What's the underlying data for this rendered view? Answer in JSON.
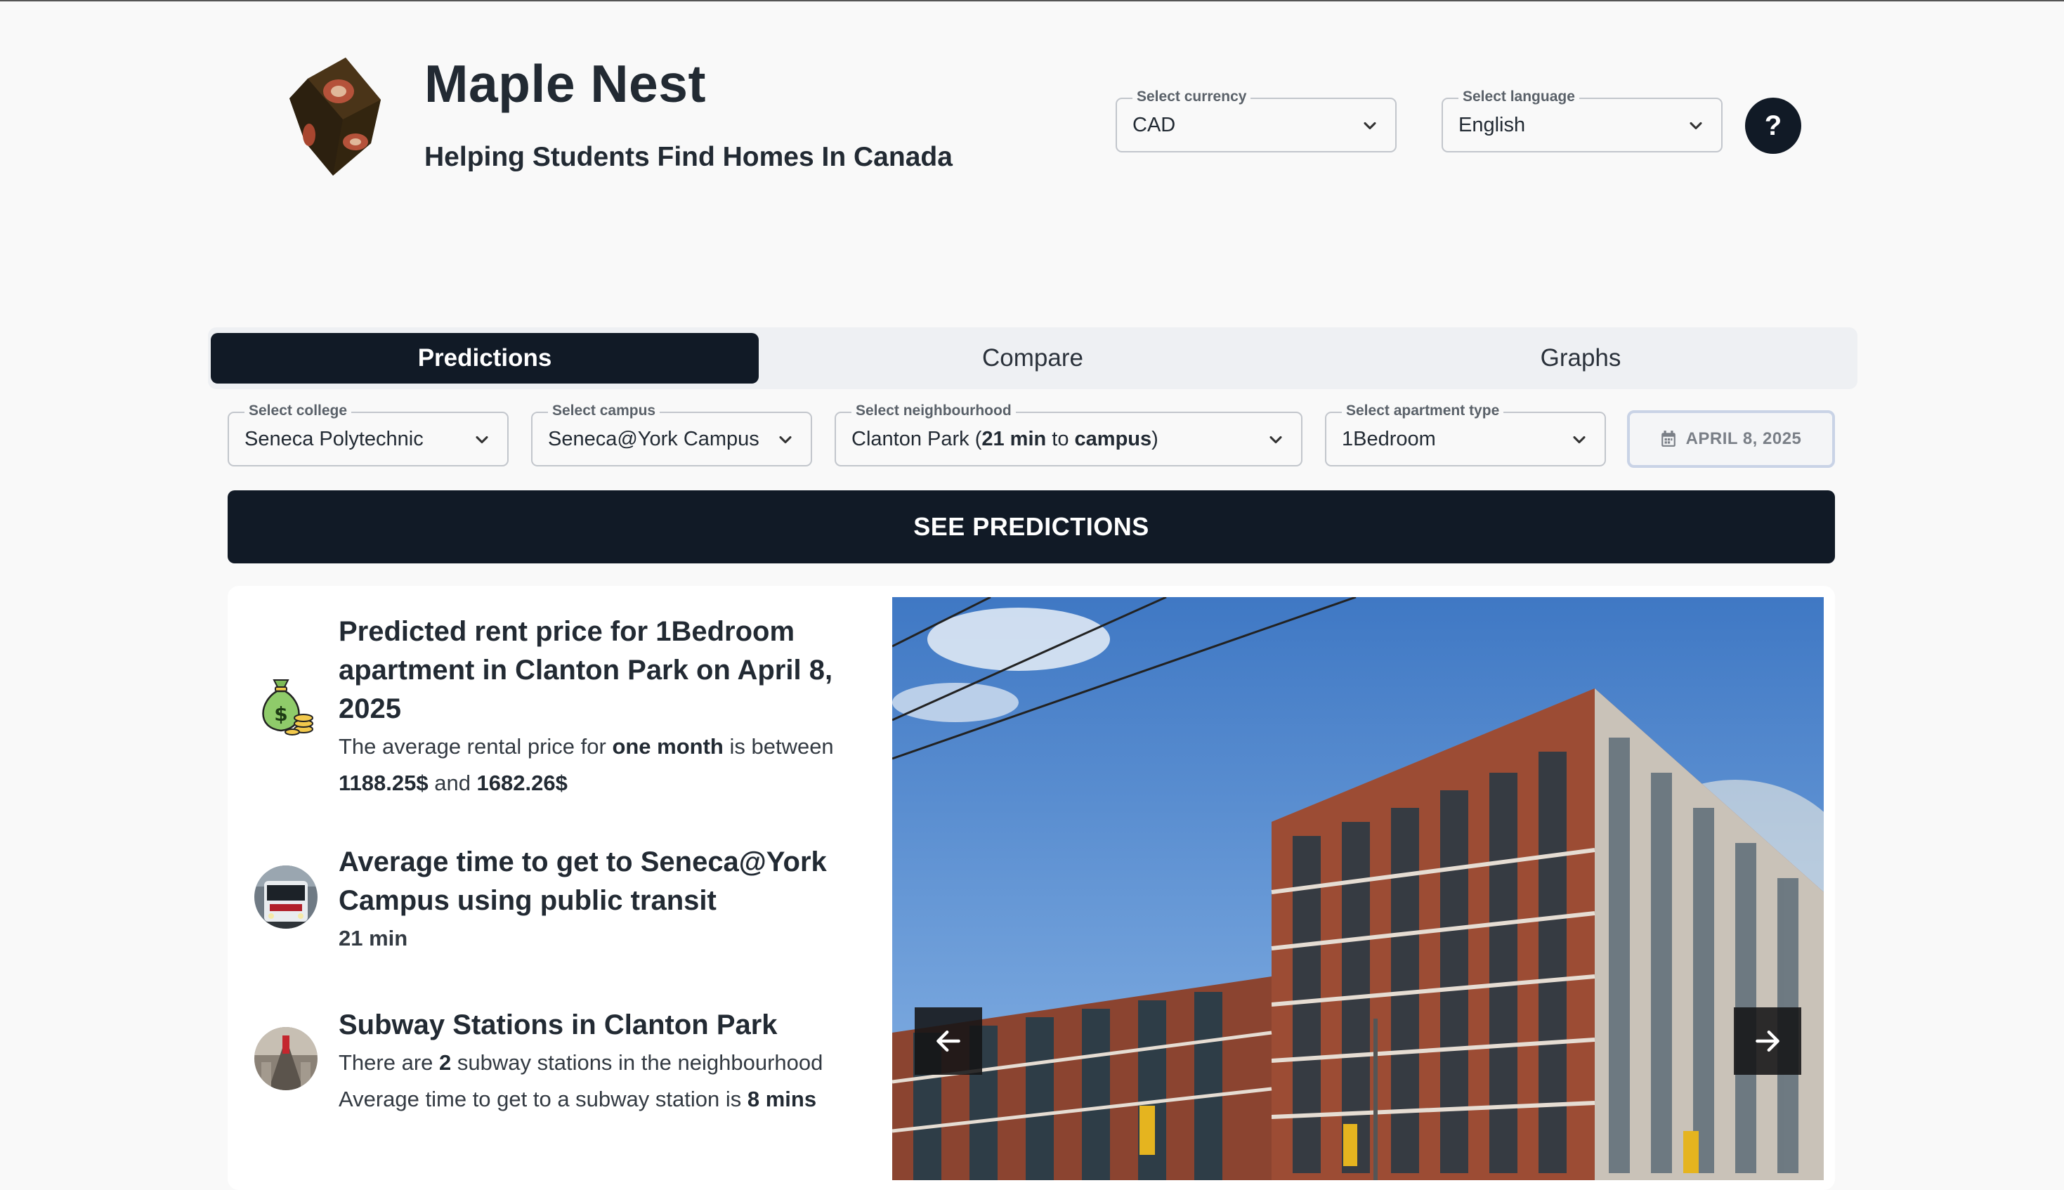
{
  "header": {
    "title": "Maple Nest",
    "subtitle": "Helping Students Find Homes In Canada",
    "currency": {
      "label": "Select currency",
      "value": "CAD"
    },
    "language": {
      "label": "Select language",
      "value": "English"
    },
    "help_label": "?"
  },
  "tabs": [
    {
      "label": "Predictions",
      "active": true
    },
    {
      "label": "Compare",
      "active": false
    },
    {
      "label": "Graphs",
      "active": false
    }
  ],
  "filters": {
    "college": {
      "label": "Select college",
      "value": "Seneca Polytechnic"
    },
    "campus": {
      "label": "Select campus",
      "value": "Seneca@York Campus"
    },
    "neighbourhood": {
      "label": "Select neighbourhood",
      "name": "Clanton Park (",
      "minutes": "21 min",
      "to": " to ",
      "campus_word": "campus",
      "close": ")"
    },
    "apartment_type": {
      "label": "Select apartment type",
      "value": "1Bedroom"
    },
    "date": "APRIL 8, 2025"
  },
  "see_predictions": "SEE PREDICTIONS",
  "results": {
    "rent": {
      "title": "Predicted rent price for 1Bedroom apartment in Clanton Park on April 8, 2025",
      "text_prefix": "The average rental price for ",
      "text_bold": "one month",
      "text_mid": " is between",
      "low": "1188.25$",
      "and": " and ",
      "high": "1682.26$"
    },
    "transit": {
      "title": "Average time to get to Seneca@York Campus using public transit",
      "value": "21 min"
    },
    "subway": {
      "title": "Subway Stations in Clanton Park",
      "line1_prefix": "There are ",
      "count": "2",
      "line1_suffix": " subway stations in the neighbourhood",
      "line2_prefix": "Average time to get to a subway station is ",
      "time": "8 mins"
    }
  },
  "icons": {
    "logo": "cube-logo-icon",
    "chevron": "chevron-down-icon",
    "calendar": "calendar-icon",
    "money": "money-bag-icon",
    "bus": "bus-icon",
    "subway": "subway-icon",
    "prev": "arrow-left-icon",
    "next": "arrow-right-icon"
  },
  "colors": {
    "primary": "#111a26",
    "background": "#f9f9f9",
    "text": "#222a33"
  }
}
